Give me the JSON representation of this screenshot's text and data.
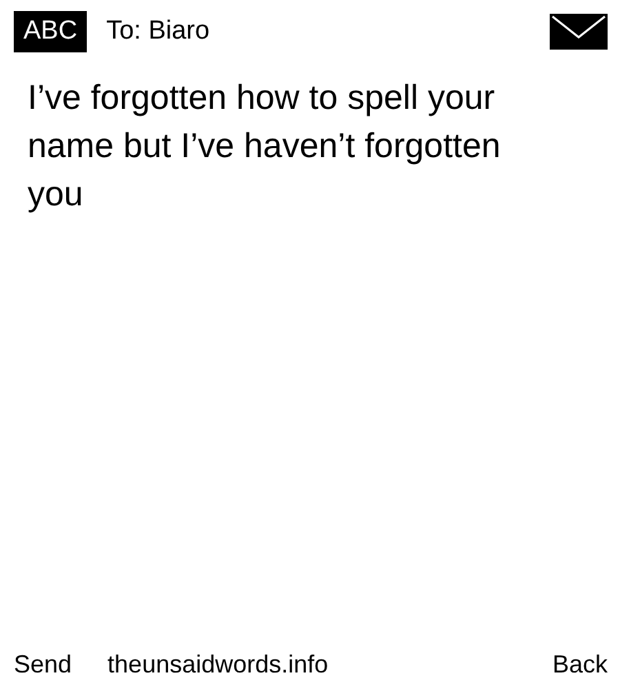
{
  "header": {
    "input_mode": "ABC",
    "recipient": "To: Biaro"
  },
  "message": "I’ve forgotten how to spell your name but I’ve haven’t forgotten you",
  "footer": {
    "left_softkey": "Send",
    "site": "theunsaidwords.info",
    "right_softkey": "Back"
  }
}
